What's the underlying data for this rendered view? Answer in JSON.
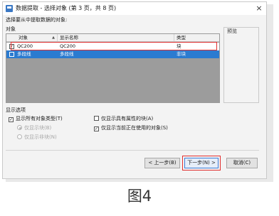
{
  "window": {
    "title": "数据提取 - 选择对象 (第 3 页，共 8 页)",
    "close_glyph": "×"
  },
  "instruction": "选择要从中提取数据的对象:",
  "objects_label": "对象",
  "grid": {
    "headers": {
      "object": "对象",
      "display_name": "显示名称",
      "type": "类型"
    },
    "rows": [
      {
        "checked": true,
        "object": "QC200",
        "display_name": "QC200",
        "type": "块"
      },
      {
        "checked": false,
        "object": "多段线",
        "display_name": "多段线",
        "type": "非块"
      }
    ]
  },
  "preview_label": "预览",
  "display_options": {
    "label": "显示选项",
    "show_all_types": "显示所有对象类型(T)",
    "blocks_only": "仅显示块(B)",
    "non_blocks_only": "仅显示非块(N)",
    "only_with_attributes": "仅显示具有属性的块(A)",
    "only_in_use": "仅显示当前正在使用的对象(S)"
  },
  "buttons": {
    "back": "< 上一步(B)",
    "next": "下一步(N) >",
    "cancel": "取消(C)"
  },
  "caption": "图4",
  "colors": {
    "selection": "#2b7bd0",
    "highlight_box": "#e03030",
    "grid_bg": "#9c9c9c"
  }
}
